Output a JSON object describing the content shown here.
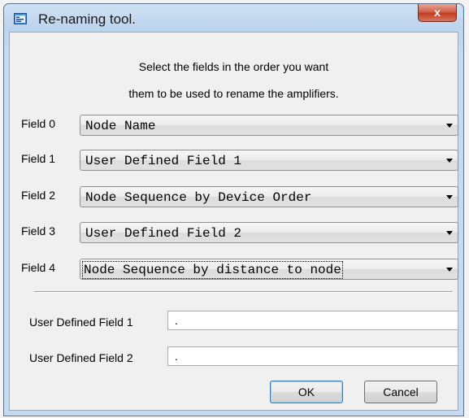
{
  "window": {
    "title": "Re-naming tool.",
    "close_glyph": "x"
  },
  "instructions": {
    "line1": "Select the fields in the order you want",
    "line2": "them to be used to rename the amplifiers."
  },
  "fields": [
    {
      "label": "Field 0",
      "value": "Node Name"
    },
    {
      "label": "Field 1",
      "value": "User Defined Field 1"
    },
    {
      "label": "Field 2",
      "value": "Node Sequence by Device Order"
    },
    {
      "label": "Field 3",
      "value": "User Defined Field 2"
    },
    {
      "label": "Field 4",
      "value": "Node Sequence by distance to node"
    }
  ],
  "user_fields": [
    {
      "label": "User Defined Field 1",
      "value": "."
    },
    {
      "label": "User Defined Field 2",
      "value": "."
    }
  ],
  "buttons": {
    "ok": "OK",
    "cancel": "Cancel"
  }
}
